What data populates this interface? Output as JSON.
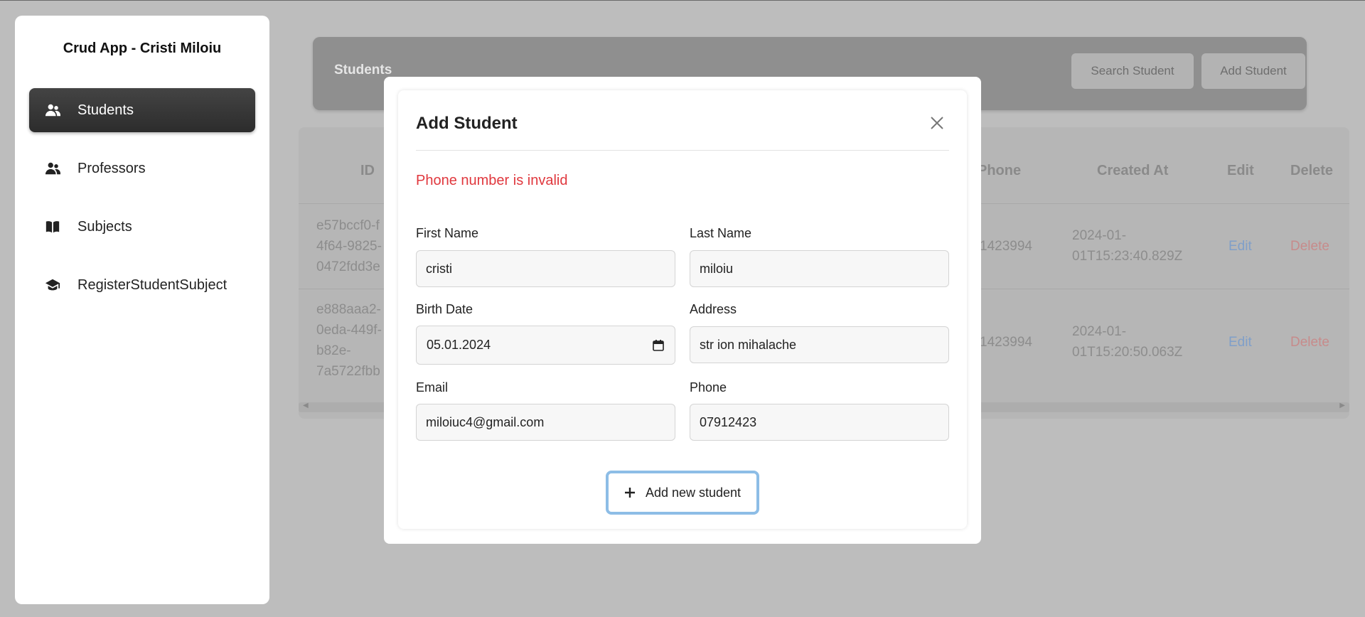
{
  "sidebar": {
    "app_title": "Crud App - Cristi Miloiu",
    "items": [
      {
        "label": "Students",
        "icon": "users-icon",
        "active": true
      },
      {
        "label": "Professors",
        "icon": "users-icon",
        "active": false
      },
      {
        "label": "Subjects",
        "icon": "book-icon",
        "active": false
      },
      {
        "label": "RegisterStudentSubject",
        "icon": "graduation-cap-icon",
        "active": false
      }
    ]
  },
  "header": {
    "title": "Students",
    "search_label": "Search Student",
    "add_label": "Add Student"
  },
  "table": {
    "columns": [
      "ID",
      "Phone",
      "Created At",
      "Edit",
      "Delete"
    ],
    "rows": [
      {
        "id_lines": [
          "e57bccf0-f",
          "4f64-9825-",
          "0472fdd3e"
        ],
        "phone": "1423994",
        "created_lines": [
          "2024-01-",
          "01T15:23:40.829Z"
        ],
        "edit": "Edit",
        "delete": "Delete"
      },
      {
        "id_lines": [
          "e888aaa2-",
          "0eda-449f-",
          "b82e-",
          "7a5722fbb"
        ],
        "phone": "1423994",
        "created_lines": [
          "2024-01-",
          "01T15:20:50.063Z"
        ],
        "edit": "Edit",
        "delete": "Delete"
      }
    ]
  },
  "modal": {
    "title": "Add Student",
    "error": "Phone number is invalid",
    "fields": {
      "first_name": {
        "label": "First Name",
        "value": "cristi"
      },
      "last_name": {
        "label": "Last Name",
        "value": "miloiu"
      },
      "birth_date": {
        "label": "Birth Date",
        "value": "05.01.2024"
      },
      "address": {
        "label": "Address",
        "value": "str ion mihalache"
      },
      "email": {
        "label": "Email",
        "value": "miloiuc4@gmail.com"
      },
      "phone": {
        "label": "Phone",
        "value": "07912423"
      }
    },
    "submit_label": "Add new student"
  },
  "colors": {
    "error": "#e0383e",
    "active_nav": "#2c2c2c",
    "focus_ring": "#8dbde6"
  }
}
